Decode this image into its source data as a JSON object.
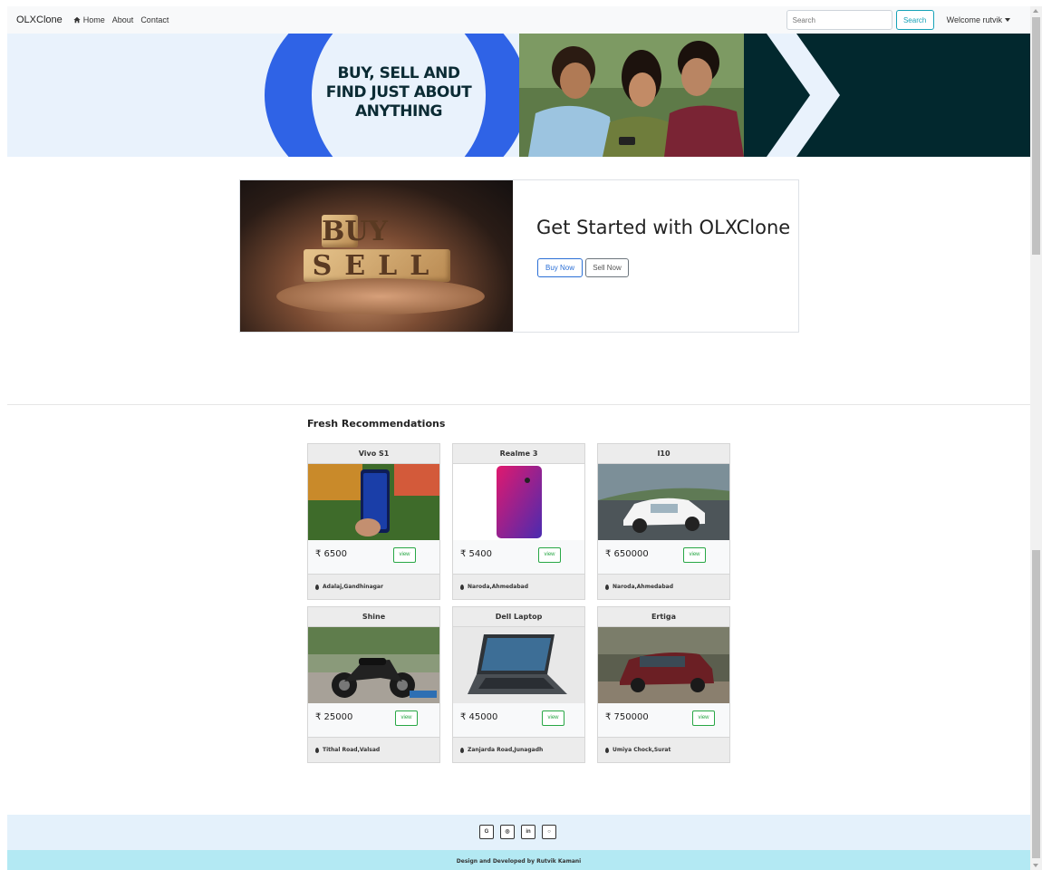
{
  "navbar": {
    "brand": "OLXClone",
    "links": [
      {
        "label": "Home",
        "icon": "home-icon"
      },
      {
        "label": "About"
      },
      {
        "label": "Contact"
      }
    ],
    "search_placeholder": "Search",
    "search_button": "Search",
    "welcome": "Welcome rutvik"
  },
  "hero": {
    "tagline_lines": [
      "BUY, SELL AND",
      "FIND JUST ABOUT",
      "ANYTHING"
    ],
    "colors": {
      "ring": "#2f63e6",
      "dark_panel": "#02282e",
      "background": "#e9f2fc"
    }
  },
  "get_started": {
    "title": "Get Started with OLXClone",
    "buy_button": "Buy Now",
    "sell_button": "Sell Now",
    "image_text": [
      "BUY",
      "SELL"
    ]
  },
  "recommendations": {
    "title": "Fresh Recommendations",
    "items": [
      {
        "name": "Vivo S1",
        "price": "₹ 6500",
        "view": "view",
        "location": "Adalaj,Gandhinagar"
      },
      {
        "name": "Realme 3",
        "price": "₹ 5400",
        "view": "view",
        "location": "Naroda,Ahmedabad"
      },
      {
        "name": "I10",
        "price": "₹ 650000",
        "view": "view",
        "location": "Naroda,Ahmedabad"
      },
      {
        "name": "Shine",
        "price": "₹ 25000",
        "view": "view",
        "location": "Tithal Road,Valsad"
      },
      {
        "name": "Dell Laptop",
        "price": "₹ 45000",
        "view": "view",
        "location": "Zanjarda Road,Junagadh"
      },
      {
        "name": "Ertiga",
        "price": "₹ 750000",
        "view": "view",
        "location": "Umiya Chock,Surat"
      }
    ]
  },
  "footer": {
    "social": [
      {
        "label": "G",
        "icon": "google-icon"
      },
      {
        "label": "◎",
        "icon": "instagram-icon"
      },
      {
        "label": "in",
        "icon": "linkedin-icon"
      },
      {
        "label": "○",
        "icon": "github-icon"
      }
    ],
    "credit": "Design and Developed by Rutvik Kamani"
  }
}
